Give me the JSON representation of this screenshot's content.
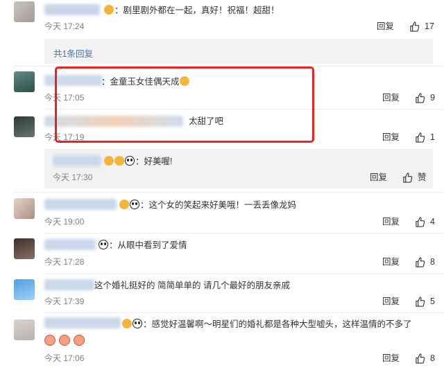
{
  "comments": [
    {
      "text": "：剧里剧外都在一起，真好！祝福！超甜！",
      "time": "今天 17:24",
      "reply": "回复",
      "likes": "17"
    },
    {
      "text": "：金童玉女佳偶天成",
      "time": "今天 17:05",
      "reply": "回复",
      "likes": "9"
    },
    {
      "text": "太甜了吧",
      "time": "今天 17:19",
      "reply": "回复",
      "likes": "1"
    },
    {
      "text": "：这个女的笑起来好美哦！一丢丢像龙妈",
      "time": "今天 19:00",
      "reply": "回复",
      "likes": "4"
    },
    {
      "text": "：从眼中看到了爱情",
      "time": "今天 17:28",
      "reply": "回复",
      "likes": "8"
    },
    {
      "text": "这个婚礼挺好的 简简单单的 请几个最好的朋友亲戚",
      "time": "今天 17:39",
      "reply": "回复",
      "likes": "5"
    },
    {
      "text": "：感觉好温馨啊～明星们的婚礼都是各种大型嘘头，这样温情的不多了",
      "time": "今天 17:06",
      "reply": "回复",
      "likes": "8"
    }
  ],
  "thread": {
    "reply_count_link": "共1条回复"
  },
  "subreply": {
    "text": "：好美喔!",
    "time": "今天 17:30",
    "reply": "回复",
    "likes": "赞"
  },
  "colors": {
    "link": "#4d72a5",
    "highlight_box": "#e8221d",
    "text": "#333333",
    "time": "#808080"
  }
}
